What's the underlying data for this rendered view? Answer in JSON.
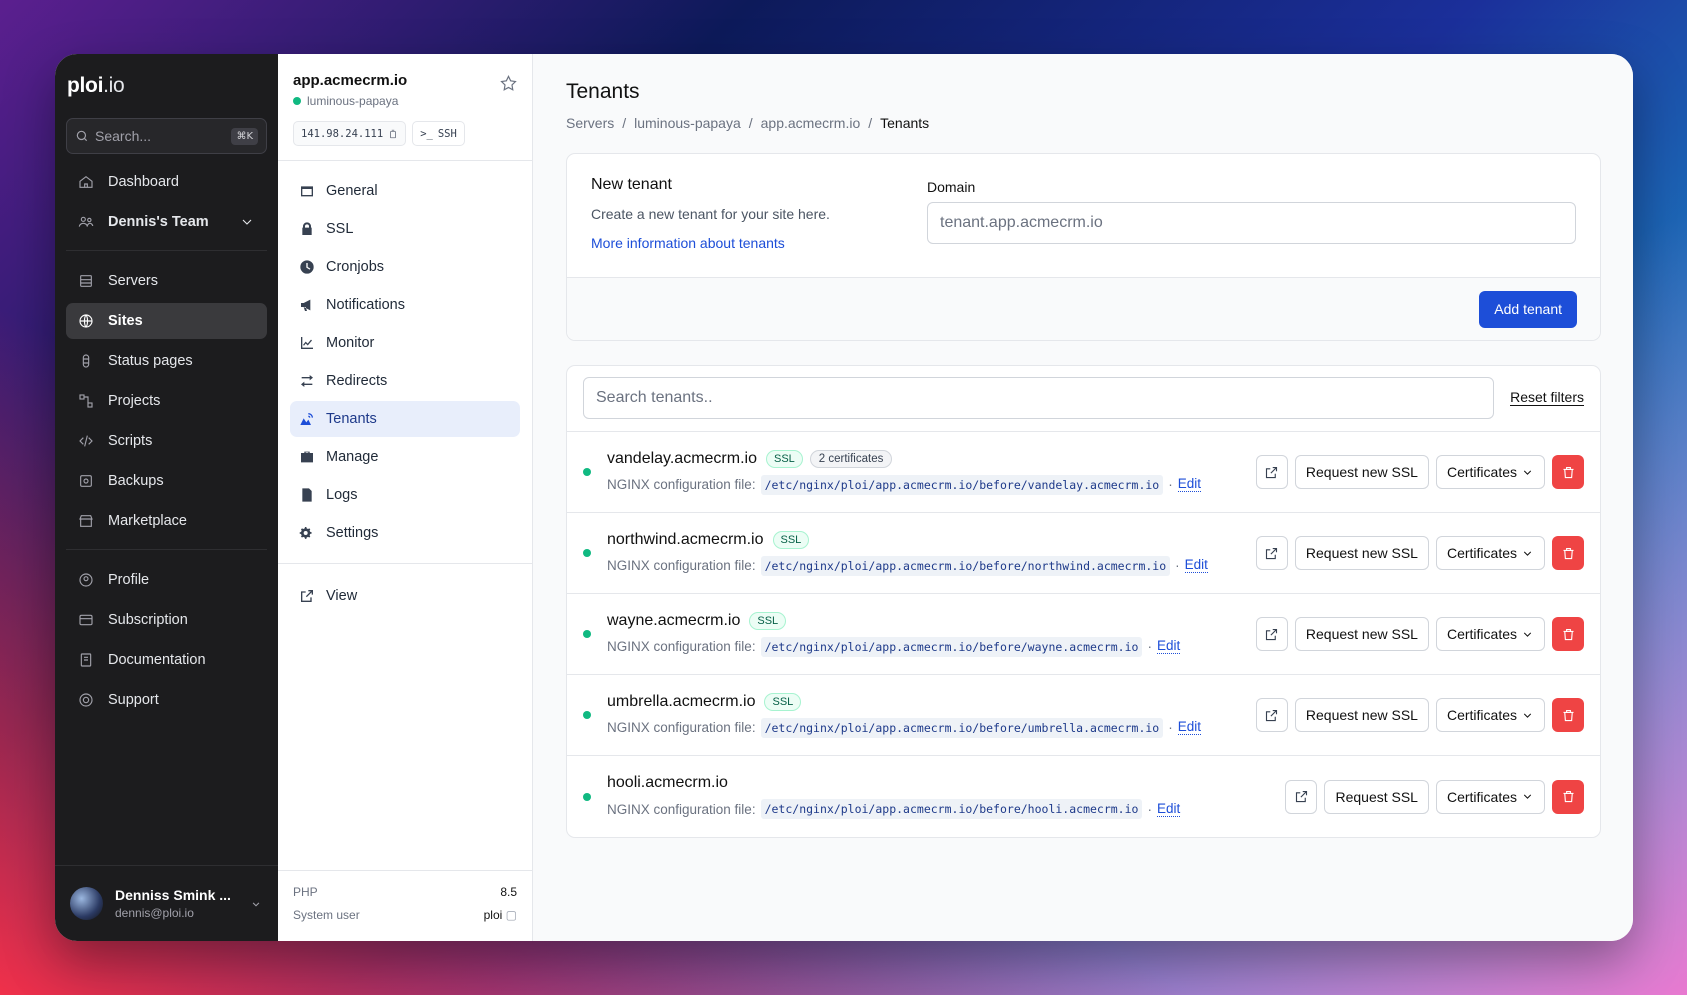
{
  "brand": {
    "name_bold": "ploi",
    "name_rest": ".io"
  },
  "search": {
    "placeholder": "Search...",
    "shortcut": "⌘K"
  },
  "sidebar": {
    "top": [
      {
        "label": "Dashboard",
        "icon": "home-icon"
      },
      {
        "label": "Dennis's Team",
        "icon": "team-icon"
      }
    ],
    "main": [
      {
        "label": "Servers",
        "icon": "server-icon"
      },
      {
        "label": "Sites",
        "icon": "globe-icon",
        "active": true
      },
      {
        "label": "Status pages",
        "icon": "status-icon"
      },
      {
        "label": "Projects",
        "icon": "projects-icon"
      },
      {
        "label": "Scripts",
        "icon": "code-icon"
      },
      {
        "label": "Backups",
        "icon": "backup-icon"
      },
      {
        "label": "Marketplace",
        "icon": "store-icon"
      }
    ],
    "bottom": [
      {
        "label": "Profile",
        "icon": "profile-icon"
      },
      {
        "label": "Subscription",
        "icon": "card-icon"
      },
      {
        "label": "Documentation",
        "icon": "book-icon"
      },
      {
        "label": "Support",
        "icon": "support-icon"
      }
    ],
    "user": {
      "name": "Denniss Smink ...",
      "email": "dennis@ploi.io"
    }
  },
  "site": {
    "title": "app.acmecrm.io",
    "server": "luminous-papaya",
    "ip": "141.98.24.111",
    "ssh": "SSH",
    "nav": [
      "General",
      "SSL",
      "Cronjobs",
      "Notifications",
      "Monitor",
      "Redirects",
      "Tenants",
      "Manage",
      "Logs",
      "Settings"
    ],
    "active": "Tenants",
    "view": "View",
    "php_label": "PHP",
    "php_value": "8.5",
    "user_label": "System user",
    "user_value": "ploi"
  },
  "page": {
    "title": "Tenants",
    "breadcrumb": [
      "Servers",
      "luminous-papaya",
      "app.acmecrm.io",
      "Tenants"
    ]
  },
  "new_tenant": {
    "title": "New tenant",
    "description": "Create a new tenant for your site here.",
    "link": "More information about tenants",
    "domain_label": "Domain",
    "domain_placeholder": "tenant.app.acmecrm.io",
    "button": "Add tenant"
  },
  "tenants": {
    "search_placeholder": "Search tenants..",
    "reset": "Reset filters",
    "config_label": "NGINX configuration file:",
    "edit": "Edit",
    "certificates": "Certificates",
    "colors": {
      "status": "#10b981",
      "danger": "#ef4444",
      "primary": "#1d4ed8"
    },
    "items": [
      {
        "name": "vandelay.acmecrm.io",
        "ssl": "SSL",
        "certs": "2 certificates",
        "path": "/etc/nginx/ploi/app.acmecrm.io/before/vandelay.acmecrm.io",
        "request": "Request new SSL"
      },
      {
        "name": "northwind.acmecrm.io",
        "ssl": "SSL",
        "certs": "",
        "path": "/etc/nginx/ploi/app.acmecrm.io/before/northwind.acmecrm.io",
        "request": "Request new SSL"
      },
      {
        "name": "wayne.acmecrm.io",
        "ssl": "SSL",
        "certs": "",
        "path": "/etc/nginx/ploi/app.acmecrm.io/before/wayne.acmecrm.io",
        "request": "Request new SSL"
      },
      {
        "name": "umbrella.acmecrm.io",
        "ssl": "SSL",
        "certs": "",
        "path": "/etc/nginx/ploi/app.acmecrm.io/before/umbrella.acmecrm.io",
        "request": "Request new SSL"
      },
      {
        "name": "hooli.acmecrm.io",
        "ssl": "",
        "certs": "",
        "path": "/etc/nginx/ploi/app.acmecrm.io/before/hooli.acmecrm.io",
        "request": "Request SSL"
      }
    ]
  }
}
